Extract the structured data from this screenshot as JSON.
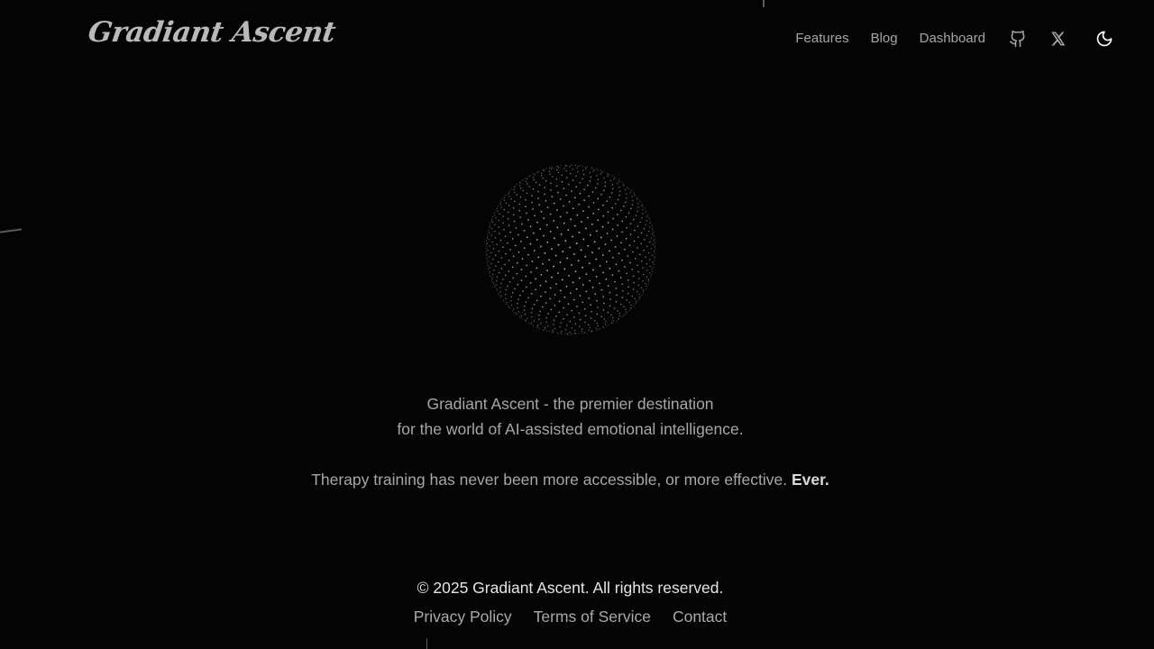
{
  "header": {
    "logo_text": "Gradiant Ascent",
    "nav": {
      "features": "Features",
      "blog": "Blog",
      "dashboard": "Dashboard"
    },
    "icons": {
      "github": "github-icon",
      "x": "x-icon",
      "theme": "moon-icon"
    }
  },
  "hero": {
    "line1": "Gradiant Ascent - the premier destination",
    "line2": "for the world of AI-assisted emotional intelligence.",
    "line3": "Therapy training has never been more accessible, or more effective.",
    "emphasis": "Ever."
  },
  "footer": {
    "copyright": "© 2025 Gradiant Ascent. All rights reserved.",
    "links": {
      "privacy": "Privacy Policy",
      "terms": "Terms of Service",
      "contact": "Contact"
    }
  },
  "colors": {
    "background": "#040404",
    "text_muted": "#a7a7a7",
    "text_bright": "#e6e6e6",
    "orb_dots": "#cfcfcf"
  }
}
